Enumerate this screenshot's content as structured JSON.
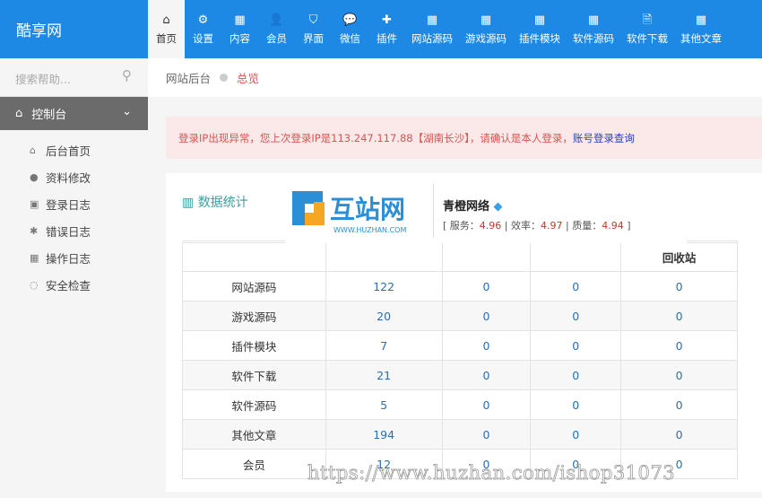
{
  "app": {
    "title": "酷享网"
  },
  "nav": [
    {
      "label": "首页",
      "icon": "home-icon",
      "glyph": "⌂",
      "active": true
    },
    {
      "label": "设置",
      "icon": "gear-icon",
      "glyph": "⚙"
    },
    {
      "label": "内容",
      "icon": "grid-icon",
      "glyph": "▦"
    },
    {
      "label": "会员",
      "icon": "user-icon",
      "glyph": "👤"
    },
    {
      "label": "界面",
      "icon": "html5-icon",
      "glyph": "⛉"
    },
    {
      "label": "微信",
      "icon": "wechat-icon",
      "glyph": "💬"
    },
    {
      "label": "插件",
      "icon": "puzzle-icon",
      "glyph": "✚"
    },
    {
      "label": "网站源码",
      "icon": "table-icon",
      "glyph": "▦"
    },
    {
      "label": "游戏源码",
      "icon": "table-icon",
      "glyph": "▦"
    },
    {
      "label": "插件模块",
      "icon": "table-icon",
      "glyph": "▦"
    },
    {
      "label": "软件源码",
      "icon": "table-icon",
      "glyph": "▦"
    },
    {
      "label": "软件下载",
      "icon": "file-code-icon",
      "glyph": "🗎"
    },
    {
      "label": "其他文章",
      "icon": "table-icon",
      "glyph": "▦"
    }
  ],
  "sidebar": {
    "search_placeholder": "搜索帮助...",
    "section": "控制台",
    "items": [
      {
        "label": "后台首页",
        "glyph": "⌂"
      },
      {
        "label": "资料修改",
        "glyph": "●"
      },
      {
        "label": "登录日志",
        "glyph": "▣"
      },
      {
        "label": "错误日志",
        "glyph": "✱"
      },
      {
        "label": "操作日志",
        "glyph": "▦"
      },
      {
        "label": "安全检查",
        "glyph": "◌"
      }
    ]
  },
  "breadcrumb": {
    "root": "网站后台",
    "current": "总览"
  },
  "alert": {
    "text": "登录IP出现异常，您上次登录IP是113.247.117.88【湖南长沙】，请确认是本人登录，",
    "link": "账号登录查询"
  },
  "panel": {
    "title": "数据统计"
  },
  "table": {
    "headers": [
      "",
      "",
      "",
      "",
      "回收站"
    ],
    "rows": [
      [
        "网站源码",
        "122",
        "0",
        "0",
        "0"
      ],
      [
        "游戏源码",
        "20",
        "0",
        "0",
        "0"
      ],
      [
        "插件模块",
        "7",
        "0",
        "0",
        "0"
      ],
      [
        "软件下载",
        "21",
        "0",
        "0",
        "0"
      ],
      [
        "软件源码",
        "5",
        "0",
        "0",
        "0"
      ],
      [
        "其他文章",
        "194",
        "0",
        "0",
        "0"
      ],
      [
        "会员",
        "12",
        "0",
        "0",
        "0"
      ]
    ]
  },
  "watermark": {
    "logo_text": "互站网",
    "logo_url": "WWW.HUZHAN.COM",
    "vendor": "青橙网络",
    "service_label": "服务：",
    "service": "4.96",
    "efficiency_label": "效率：",
    "efficiency": "4.97",
    "quality_label": "质量：",
    "quality": "4.94",
    "url": "https://www.huzhan.com/ishop31073"
  }
}
